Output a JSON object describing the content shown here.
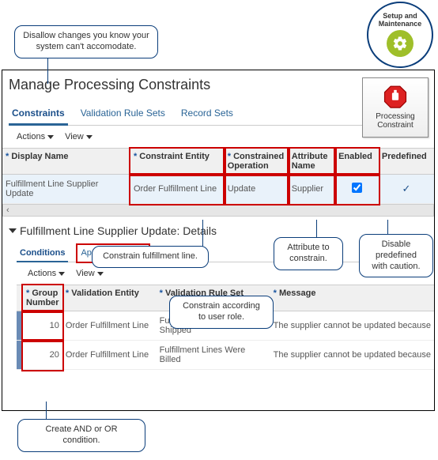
{
  "setup_badge": "Setup and Maintenance",
  "processing_badge": {
    "line1": "Processing",
    "line2": "Constraint"
  },
  "callouts": {
    "disallow": "Disallow changes you know your system can't accomodate.",
    "constrain_fulfillment": "Constrain fulfillment line.",
    "attribute_to_constrain": "Attribute to constrain.",
    "disable_predefined": "Disable predefined with caution.",
    "constrain_role": "Constrain according to user role.",
    "create_and_or": "Create AND or OR condition."
  },
  "page_title": "Manage Processing Constraints",
  "tabs": {
    "constraints": "Constraints",
    "validation_rule_sets": "Validation Rule Sets",
    "record_sets": "Record Sets"
  },
  "toolbar": {
    "actions": "Actions",
    "view": "View"
  },
  "constraints_table": {
    "headers": {
      "display_name": "Display Name",
      "constraint_entity": "Constraint Entity",
      "constrained_operation": "Constrained Operation",
      "attribute_name": "Attribute Name",
      "enabled": "Enabled",
      "predefined": "Predefined"
    },
    "row": {
      "display_name": "Fulfillment Line Supplier Update",
      "constraint_entity": "Order Fulfillment Line",
      "constrained_operation": "Update",
      "attribute_name": "Supplier",
      "enabled": true,
      "predefined": true
    }
  },
  "details_title": "Fulfillment Line Supplier Update: Details",
  "sub_tabs": {
    "conditions": "Conditions",
    "applicable_roles": "Applicable Roles"
  },
  "conditions_table": {
    "headers": {
      "group_number": "Group Number",
      "validation_entity": "Validation Entity",
      "validation_rule_set": "Validation Rule Set",
      "message": "Message"
    },
    "rows": [
      {
        "group_number": "10",
        "validation_entity": "Order Fulfillment Line",
        "validation_rule_set": "Fulfillment Lines Were Shipped",
        "message": "The supplier cannot be updated because"
      },
      {
        "group_number": "20",
        "validation_entity": "Order Fulfillment Line",
        "validation_rule_set": "Fulfillment Lines Were Billed",
        "message": "The supplier cannot be updated because"
      }
    ]
  }
}
